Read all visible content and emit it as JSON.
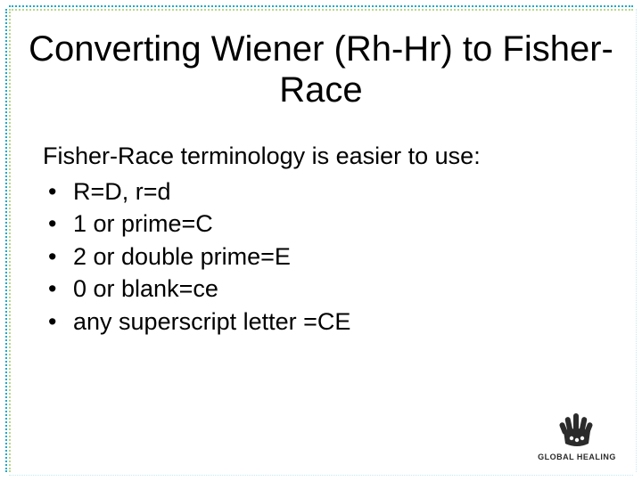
{
  "title": "Converting Wiener (Rh-Hr) to Fisher-Race",
  "intro": "Fisher-Race terminology is easier to use:",
  "bullets": [
    "R=D, r=d",
    "1 or prime=C",
    "2 or double prime=E",
    "0 or blank=ce",
    "any superscript letter =CE"
  ],
  "logo_text": "GLOBAL HEALING"
}
